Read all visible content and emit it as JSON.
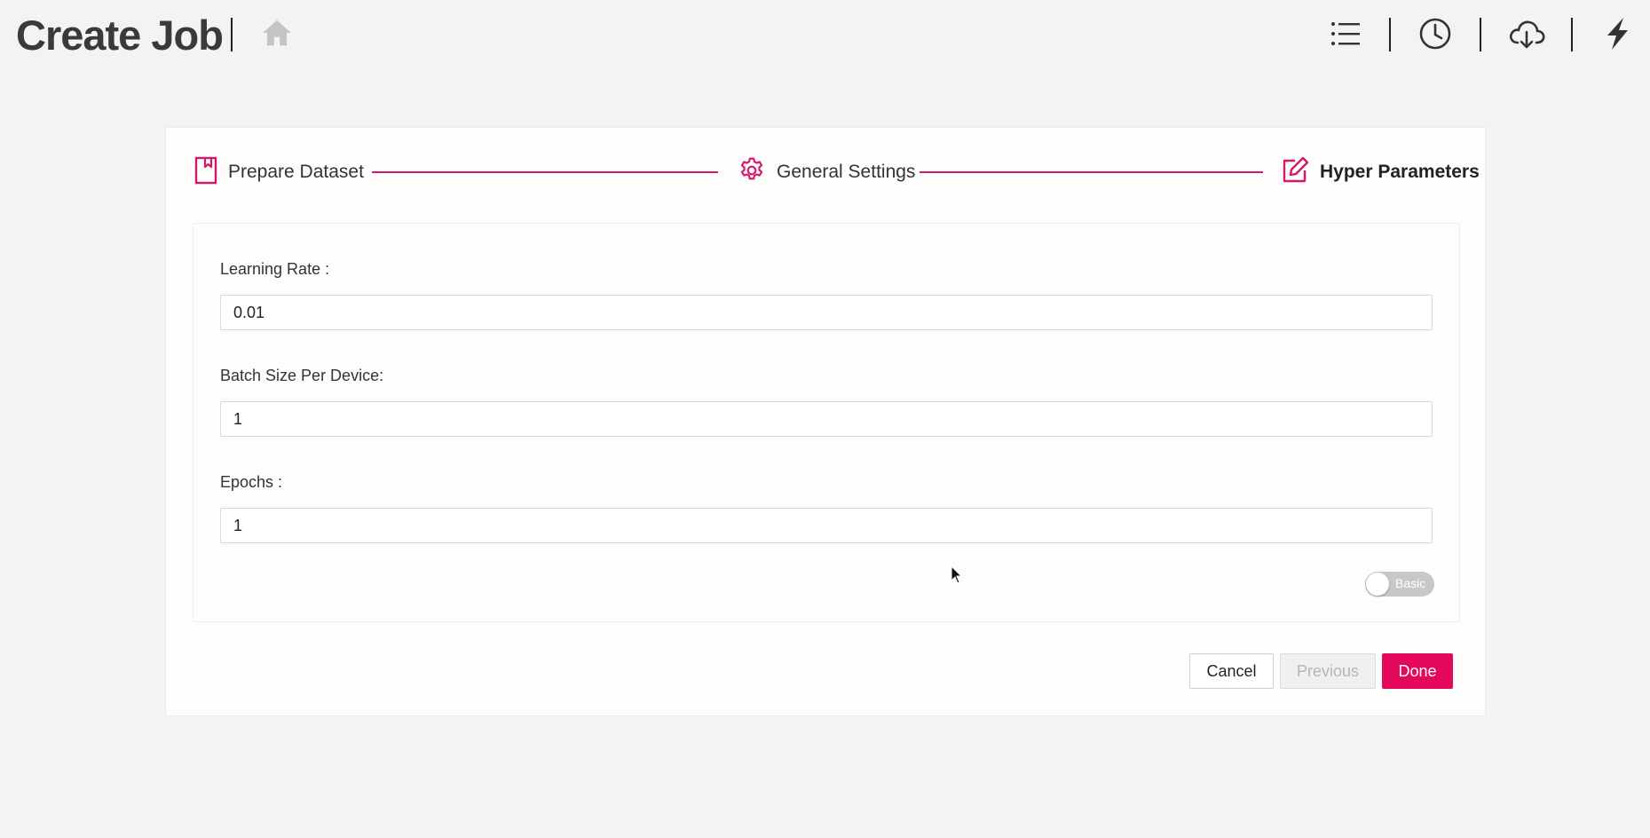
{
  "header": {
    "title": "Create Job",
    "icons": [
      "home-icon",
      "list-icon",
      "clock-icon",
      "cloud-download-icon",
      "lightning-icon"
    ]
  },
  "stepper": {
    "steps": [
      {
        "label": "Prepare Dataset",
        "icon": "bookmark-icon",
        "active": false
      },
      {
        "label": "General Settings",
        "icon": "gear-icon",
        "active": false
      },
      {
        "label": "Hyper Parameters",
        "icon": "edit-icon",
        "active": true
      }
    ]
  },
  "form": {
    "learning_rate": {
      "label": "Learning Rate :",
      "value": "0.01"
    },
    "batch_size": {
      "label": "Batch Size Per Device:",
      "value": "1"
    },
    "epochs": {
      "label": "Epochs :",
      "value": "1"
    },
    "mode_toggle": {
      "label": "Basic",
      "on": false
    }
  },
  "buttons": {
    "cancel": "Cancel",
    "previous": "Previous",
    "done": "Done"
  },
  "colors": {
    "accent": "#d6176a",
    "primary_button": "#e3085a",
    "background": "#f3f4f2"
  }
}
